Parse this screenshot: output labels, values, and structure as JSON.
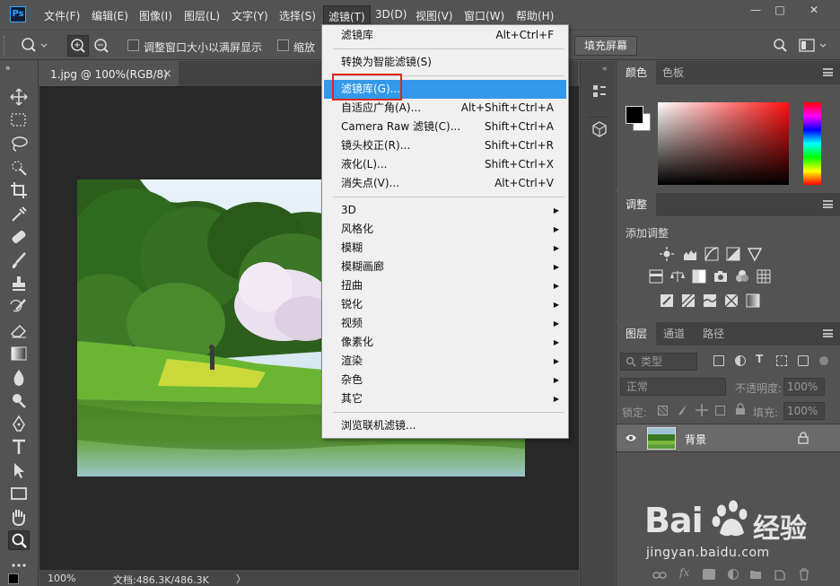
{
  "app": {
    "logo": "Ps"
  },
  "menubar": {
    "items": [
      "文件(F)",
      "编辑(E)",
      "图像(I)",
      "图层(L)",
      "文字(Y)",
      "选择(S)",
      "滤镜(T)",
      "3D(D)",
      "视图(V)",
      "窗口(W)",
      "帮助(H)"
    ],
    "active_index": 6
  },
  "window_controls": {
    "minimize": "—",
    "maximize": "□",
    "close": "✕"
  },
  "options": {
    "resize_windows": "调整窗口大小以满屏显示",
    "zoom_all": "缩放",
    "fill_screen": "填充屏幕"
  },
  "document": {
    "tab_title": "1.jpg @ 100%(RGB/8)",
    "tab_close": "×",
    "zoom": "100%",
    "doc_info": "文档:486.3K/486.3K",
    "status_arrow": "〉"
  },
  "filter_menu": {
    "items": [
      {
        "label": "滤镜库",
        "shortcut": "Alt+Ctrl+F"
      },
      {
        "label": "转换为智能滤镜(S)",
        "shortcut": ""
      },
      {
        "label": "滤镜库(G)...",
        "shortcut": "",
        "highlighted": true
      },
      {
        "label": "自适应广角(A)...",
        "shortcut": "Alt+Shift+Ctrl+A"
      },
      {
        "label": "Camera Raw 滤镜(C)...",
        "shortcut": "Shift+Ctrl+A"
      },
      {
        "label": "镜头校正(R)...",
        "shortcut": "Shift+Ctrl+R"
      },
      {
        "label": "液化(L)...",
        "shortcut": "Shift+Ctrl+X"
      },
      {
        "label": "消失点(V)...",
        "shortcut": "Alt+Ctrl+V"
      },
      {
        "label": "3D",
        "submenu": true
      },
      {
        "label": "风格化",
        "submenu": true
      },
      {
        "label": "模糊",
        "submenu": true
      },
      {
        "label": "模糊画廊",
        "submenu": true
      },
      {
        "label": "扭曲",
        "submenu": true
      },
      {
        "label": "锐化",
        "submenu": true
      },
      {
        "label": "视频",
        "submenu": true
      },
      {
        "label": "像素化",
        "submenu": true
      },
      {
        "label": "渲染",
        "submenu": true
      },
      {
        "label": "杂色",
        "submenu": true
      },
      {
        "label": "其它",
        "submenu": true
      },
      {
        "label": "浏览联机滤镜...",
        "shortcut": ""
      }
    ],
    "submenu_arrow": "▶"
  },
  "color_panel": {
    "tabs": [
      "颜色",
      "色板"
    ],
    "foreground": "#000000",
    "background": "#ffffff"
  },
  "adjustments_panel": {
    "title": "调整",
    "add_label": "添加调整"
  },
  "layers_panel": {
    "tabs": [
      "图层",
      "通道",
      "路径"
    ],
    "kind_filter": "类型",
    "blend_mode": "正常",
    "opacity_label": "不透明度:",
    "opacity_value": "100%",
    "lock_label": "锁定:",
    "fill_label": "填充:",
    "fill_value": "100%",
    "layers": [
      {
        "name": "背景",
        "visible": true,
        "locked": true
      }
    ]
  },
  "watermark": {
    "brand_prefix": "Bai",
    "brand_suffix": "经验",
    "url": "jingyan.baidu.com"
  },
  "colors": {
    "highlight": "#3399ea",
    "annotation": "#e0281e",
    "accent": "#31a8ff"
  }
}
